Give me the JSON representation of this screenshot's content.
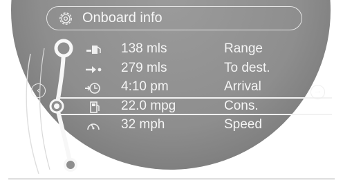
{
  "header": {
    "title": "Onboard info",
    "icon": "gear-icon"
  },
  "rows": [
    {
      "icon": "fuel-range-icon",
      "value": "138 mls",
      "label": "Range"
    },
    {
      "icon": "destination-arrow-icon",
      "value": "279 mls",
      "label": "To dest."
    },
    {
      "icon": "arrival-clock-icon",
      "value": "4:10 pm",
      "label": "Arrival"
    },
    {
      "icon": "fuel-pump-icon",
      "value": "22.0 mpg",
      "label": "Cons.",
      "selected": true
    },
    {
      "icon": "speedometer-icon",
      "value": "32 mph",
      "label": "Speed"
    }
  ],
  "nav": {
    "left_icon": "chevron-left-icon",
    "right_icon": "forward-arrow-icon"
  },
  "colors": {
    "dial": "#8e8e8e",
    "text": "#f5f5f5",
    "background": "#ffffff"
  }
}
